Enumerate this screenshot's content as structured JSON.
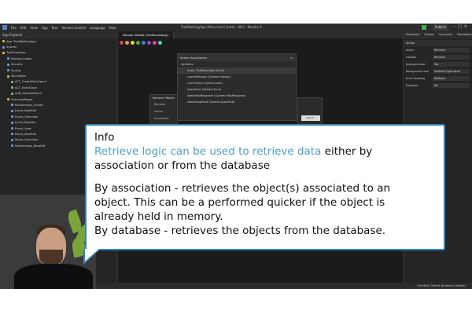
{
  "window": {
    "title": "TrailWalkingApp (Main line Create) - [Nr] - Mendix 9",
    "menu": [
      "File",
      "Edit",
      "View",
      "App",
      "Run",
      "Version Control",
      "Language",
      "Help"
    ],
    "publish_label": "Publish"
  },
  "explorer": {
    "title": "App Explorer",
    "items": [
      {
        "label": "App 'TrailWalkingApp'",
        "color": "y"
      },
      {
        "label": "System",
        "color": "b"
      },
      {
        "label": "TrailEventApp",
        "color": "y"
      },
      {
        "label": "Domain model",
        "color": "b"
      },
      {
        "label": "Security",
        "color": "b"
      },
      {
        "label": "Styling",
        "color": "b"
      },
      {
        "label": "Microflows",
        "color": "y"
      },
      {
        "label": "ACT_CreateParticipant",
        "color": "g"
      },
      {
        "label": "ACT_EventSave",
        "color": "g"
      },
      {
        "label": "SUB_ValidateEvent",
        "color": "g"
      },
      {
        "label": "OverviewPages",
        "color": "y"
      },
      {
        "label": "RouteImage_Create",
        "color": "b"
      },
      {
        "label": "Event_NewEdit",
        "color": "b"
      },
      {
        "label": "Event_Overview",
        "color": "b"
      },
      {
        "label": "Event_Register",
        "color": "b"
      },
      {
        "label": "Event_View",
        "color": "b"
      },
      {
        "label": "Route_NewEdit",
        "color": "b"
      },
      {
        "label": "Route_Overview",
        "color": "b"
      },
      {
        "label": "RouteImage_NewEdit",
        "color": "b"
      }
    ]
  },
  "editor": {
    "tab_label": "Domain Model [TrailEventApp]"
  },
  "association_dialog": {
    "title": "Select Association",
    "close": "×",
    "rows": [
      "Variables",
      "Event (TrailEventApp.Event)",
      "currentSession (System.Session)",
      "currentUser (System.User)",
      "latestError (System.Error)",
      "latestHttpResponse (System.HttpResponse)",
      "latestSoapFault (System.SoapFault)"
    ]
  },
  "retrieve_dialog": {
    "title": "Retrieve Objects",
    "items": [
      "Retrieve",
      "Source",
      "Association",
      "Output",
      "Type",
      "Object name"
    ]
  },
  "side_dialog": {
    "ok_label": "Select..."
  },
  "properties": {
    "tabs": [
      "Properties",
      "Toolbox",
      "Connector",
      "Marketplace"
    ],
    "section": "Action",
    "rows": [
      {
        "k": "Action",
        "v": "Retrieve"
      },
      {
        "k": "Caption",
        "v": "Retrieve"
      },
      {
        "k": "Auto-generate",
        "v": "Yes"
      },
      {
        "k": "Background color",
        "v": "Default (Light blue)"
      },
      {
        "k": "Error handling",
        "v": "Rollback"
      },
      {
        "k": "Disabled",
        "v": "No"
      }
    ]
  },
  "statusbar": {
    "right": "Eventlist: Default Browsers (default)"
  },
  "info": {
    "title": "Info",
    "line1_highlight": "Retrieve logic can be used to retrieve data",
    "line1_rest": " either by",
    "line2": "association or from the database",
    "line3": "By association - retrieves the object(s) associated to an",
    "line4": "object. This can be a performed quicker if the object is",
    "line5": "already held in memory.",
    "line6": "By database - retrieves the objects from the database."
  }
}
